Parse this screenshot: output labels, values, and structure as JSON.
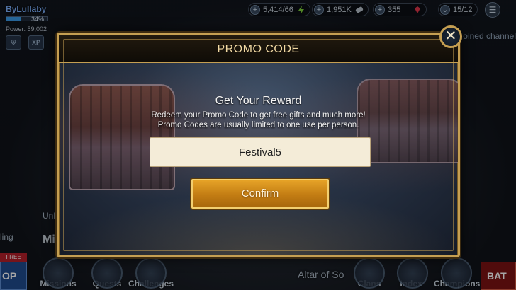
{
  "hud": {
    "player_name": "ByLullaby",
    "xp_percent_text": "34%",
    "xp_fraction": 0.34,
    "power_text": "Power: 59,002",
    "tile_labels": [
      "",
      "XP"
    ],
    "energy": "5,414/66",
    "silver": "1,951K",
    "gems": "355",
    "arena_tokens": "15/12",
    "joined_text": "oined channel"
  },
  "dialog": {
    "title": "PROMO CODE",
    "heading": "Get Your Reward",
    "line1": "Redeem your Promo Code to get free gifts and much more!",
    "line2": "Promo Codes are usually limited to one use per person.",
    "code_value": "Festival5",
    "confirm_label": "Confirm",
    "close_label": "✕"
  },
  "bottom_bar": {
    "free_tag": "FREE",
    "shop_label": "OP",
    "items": [
      "Missions",
      "Quests",
      "Challenges",
      "Clans",
      "Index",
      "Champions"
    ],
    "altar_label": "Altar of So",
    "battle_label": "BAT",
    "side_labels": [
      "Unlo",
      "ling",
      "Mi"
    ]
  }
}
